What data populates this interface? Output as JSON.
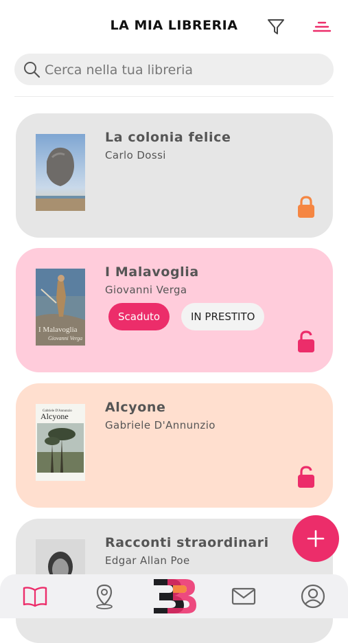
{
  "header": {
    "title": "LA MIA LIBRERIA"
  },
  "search": {
    "placeholder": "Cerca nella tua libreria",
    "value": ""
  },
  "books": [
    {
      "title": "La colonia felice",
      "author": "Carlo Dossi",
      "lock": "locked"
    },
    {
      "title": "I Malavoglia",
      "author": "Giovanni Verga",
      "status": "Scaduto",
      "tag": "IN PRESTITO",
      "lock": "unlocked"
    },
    {
      "title": "Alcyone",
      "author": "Gabriele D'Annunzio",
      "lock": "unlocked"
    },
    {
      "title": "Racconti straordinari",
      "author": "Edgar Allan Poe"
    }
  ],
  "covers": {
    "malavoglia_title": "I Malavoglia",
    "malavoglia_author": "Giovanni Verga",
    "alcyone_author": "Gabriele D'Annunzio",
    "alcyone_title": "Alcyone"
  },
  "colors": {
    "accent": "#ec2d6a",
    "card_grey": "#e6e6e6",
    "card_pink": "#ffccdb",
    "card_peach": "#ffdfcf",
    "lock_orange": "#f58642"
  },
  "icons": {
    "filter": "filter-icon",
    "sort": "sort-icon",
    "search": "search-icon",
    "add": "plus-icon",
    "nav": [
      "book-icon",
      "location-pin-icon",
      "app-logo",
      "mail-icon",
      "profile-icon"
    ]
  }
}
